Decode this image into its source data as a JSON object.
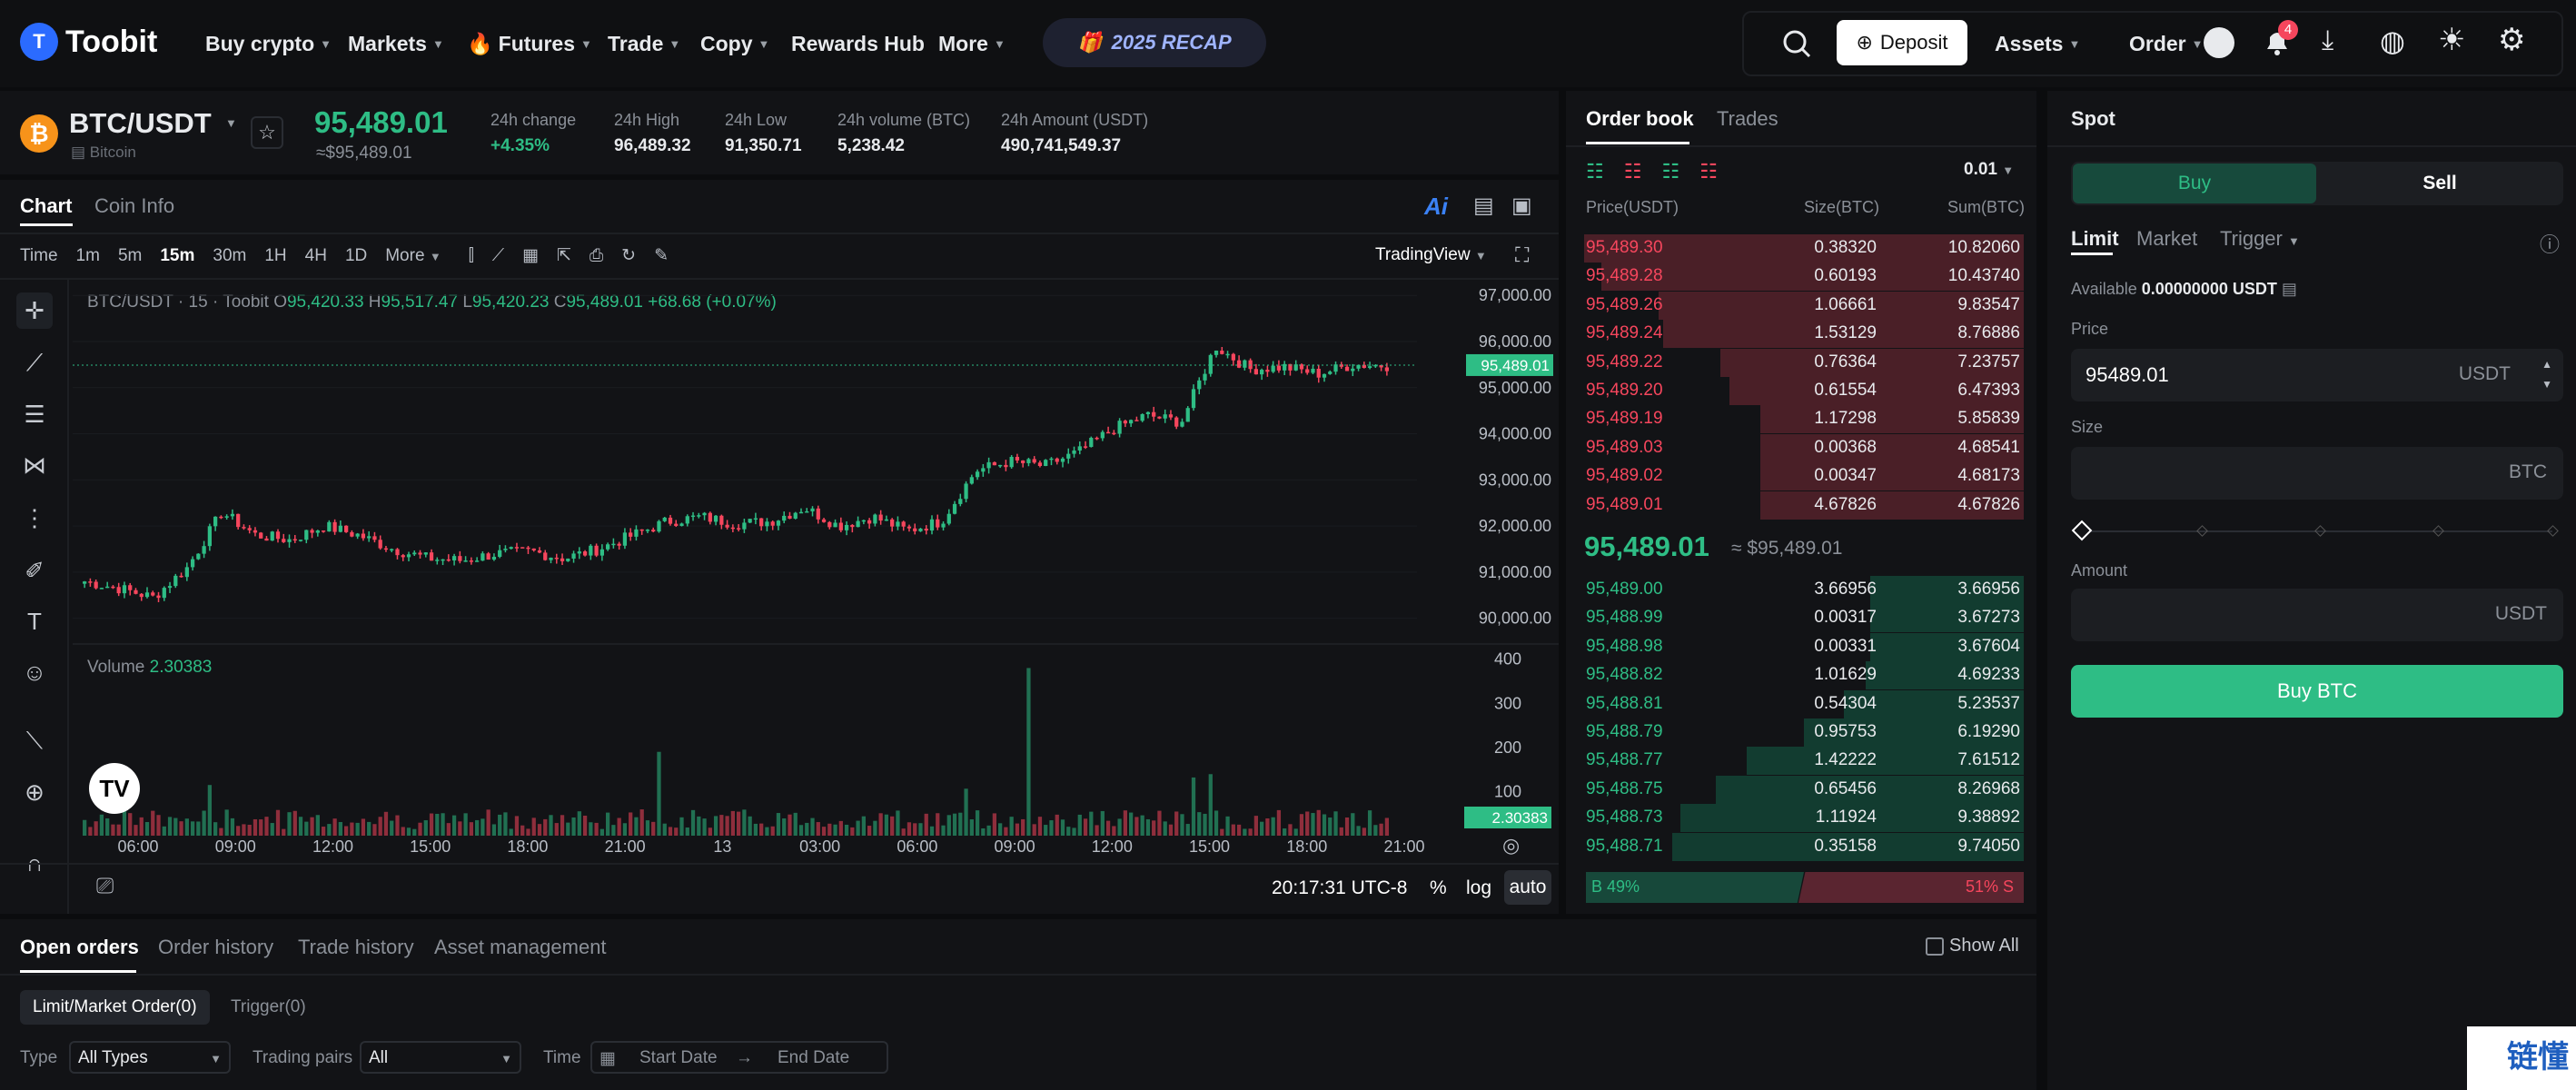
{
  "brand": {
    "name": "Toobit"
  },
  "nav": {
    "items": [
      {
        "label": "Buy crypto",
        "caret": true
      },
      {
        "label": "Markets",
        "caret": true
      },
      {
        "label": "Futures",
        "caret": true
      },
      {
        "label": "Trade",
        "caret": true
      },
      {
        "label": "Copy",
        "caret": true
      },
      {
        "label": "Rewards Hub",
        "caret": false
      },
      {
        "label": "More",
        "caret": true
      }
    ],
    "recap": "2025 RECAP"
  },
  "topright": {
    "deposit": "Deposit",
    "assets": "Assets",
    "order": "Order",
    "notifications": "4"
  },
  "ticker": {
    "pair": "BTC/USDT",
    "name": "Bitcoin",
    "price": "95,489.01",
    "price_usd": "≈$95,489.01",
    "stats": [
      {
        "label": "24h change",
        "value": "+4.35%"
      },
      {
        "label": "24h High",
        "value": "96,489.32"
      },
      {
        "label": "24h Low",
        "value": "91,350.71"
      },
      {
        "label": "24h volume (BTC)",
        "value": "5,238.42"
      },
      {
        "label": "24h Amount (USDT)",
        "value": "490,741,549.37"
      }
    ]
  },
  "chart_tabs": {
    "chart": "Chart",
    "coin_info": "Coin Info"
  },
  "intervals": [
    "Time",
    "1m",
    "5m",
    "15m",
    "30m",
    "1H",
    "4H",
    "1D",
    "More"
  ],
  "active_interval": "15m",
  "tradingview": "TradingView",
  "chart_data": {
    "type": "candlestick",
    "title": "BTC/USDT · 15 · Toobit",
    "ohlc": {
      "o_label": "O",
      "o": "95,420.33",
      "h_label": "H",
      "h": "95,517.47",
      "l_label": "L",
      "l": "95,420.23",
      "c_label": "C",
      "c": "95,489.01",
      "chg": "+68.68 (+0.07%)"
    },
    "y_ticks": [
      "97,000.00",
      "96,000.00",
      "95,000.00",
      "94,000.00",
      "93,000.00",
      "92,000.00",
      "91,000.00",
      "90,000.00"
    ],
    "ylim": [
      89500,
      97300
    ],
    "last_price": "95,489.01",
    "x_ticks": [
      "06:00",
      "09:00",
      "12:00",
      "15:00",
      "18:00",
      "21:00",
      "13",
      "03:00",
      "06:00",
      "09:00",
      "12:00",
      "15:00",
      "18:00",
      "21:00"
    ],
    "anchors": [
      90800,
      90650,
      90450,
      91100,
      92300,
      91800,
      91700,
      92000,
      91800,
      91500,
      91300,
      91250,
      91400,
      91450,
      91300,
      91500,
      91800,
      92100,
      92200,
      92050,
      92100,
      92400,
      92000,
      92200,
      91900,
      92100,
      93200,
      93400,
      93300,
      93600,
      94100,
      94400,
      94250,
      95900,
      95400,
      95450,
      95300,
      95500,
      95480
    ],
    "volume": {
      "label": "Volume",
      "value": "2.30383",
      "y_ticks": [
        "400",
        "300",
        "200",
        "100"
      ],
      "ylim": [
        0,
        420
      ],
      "last": "2.30383"
    },
    "time": "20:17:31",
    "tz": "UTC-8",
    "percent": "%",
    "log": "log",
    "auto": "auto"
  },
  "orderbook": {
    "tab_orderbook": "Order book",
    "tab_trades": "Trades",
    "precision": "0.01",
    "headers": [
      "Price(USDT)",
      "Size(BTC)",
      "Sum(BTC)"
    ],
    "asks": [
      [
        "95,489.30",
        "0.38320",
        "10.82060",
        1.0
      ],
      [
        "95,489.28",
        "0.60193",
        "10.43740",
        0.96
      ],
      [
        "95,489.26",
        "1.06661",
        "9.83547",
        0.83
      ],
      [
        "95,489.24",
        "1.53129",
        "8.76886",
        0.82
      ],
      [
        "95,489.22",
        "0.76364",
        "7.23757",
        0.69
      ],
      [
        "95,489.20",
        "0.61554",
        "6.47393",
        0.67
      ],
      [
        "95,489.19",
        "1.17298",
        "5.85839",
        0.6
      ],
      [
        "95,489.03",
        "0.00368",
        "4.68541",
        0.6
      ],
      [
        "95,489.02",
        "0.00347",
        "4.68173",
        0.6
      ],
      [
        "95,489.01",
        "4.67826",
        "4.67826",
        0.6
      ]
    ],
    "mid_price": "95,489.01",
    "mid_usd": "≈ $95,489.01",
    "bids": [
      [
        "95,489.00",
        "3.66956",
        "3.66956",
        0.35
      ],
      [
        "95,488.99",
        "0.00317",
        "3.67273",
        0.35
      ],
      [
        "95,488.98",
        "0.00331",
        "3.67604",
        0.35
      ],
      [
        "95,488.82",
        "1.01629",
        "4.69233",
        0.36
      ],
      [
        "95,488.81",
        "0.54304",
        "5.23537",
        0.41
      ],
      [
        "95,488.79",
        "0.95753",
        "6.19290",
        0.5
      ],
      [
        "95,488.77",
        "1.42222",
        "7.61512",
        0.63
      ],
      [
        "95,488.75",
        "0.65456",
        "8.26968",
        0.7
      ],
      [
        "95,488.73",
        "1.11924",
        "9.38892",
        0.78
      ],
      [
        "95,488.71",
        "0.35158",
        "9.74050",
        0.8
      ]
    ],
    "buy_pct": "B 49%",
    "sell_pct": "51% S"
  },
  "spot": {
    "title": "Spot",
    "buy": "Buy",
    "sell": "Sell",
    "types": [
      "Limit",
      "Market",
      "Trigger"
    ],
    "available_label": "Available",
    "available_value": "0.00000000 USDT",
    "price_label": "Price",
    "price_value": "95489.01",
    "price_unit": "USDT",
    "size_label": "Size",
    "size_unit": "BTC",
    "amount_label": "Amount",
    "amount_unit": "USDT",
    "submit": "Buy BTC"
  },
  "orders": {
    "tabs": [
      "Open orders",
      "Order history",
      "Trade history",
      "Asset management"
    ],
    "show_all": "Show All",
    "subtabs": [
      "Limit/Market Order(0)",
      "Trigger(0)"
    ],
    "filters": {
      "type_label": "Type",
      "type_value": "All Types",
      "pairs_label": "Trading pairs",
      "pairs_value": "All",
      "time_label": "Time",
      "start": "Start Date",
      "end": "End Date"
    }
  },
  "watermark": {
    "text": "链懂"
  }
}
